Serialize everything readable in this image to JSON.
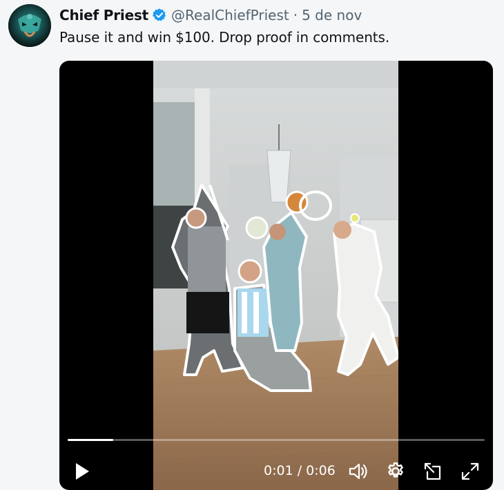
{
  "tweet": {
    "author_name": "Chief Priest",
    "handle": "@RealChiefPriest",
    "separator": "·",
    "date": "5 de nov",
    "text": "Pause it and win $100. Drop proof in comments."
  },
  "video": {
    "time_current": "0:01",
    "time_separator": "/",
    "time_total": "0:06",
    "progress_fraction": 0.11
  },
  "icons": {
    "verified": "verified-badge-icon",
    "play": "play-icon",
    "volume": "volume-icon",
    "settings": "gear-icon",
    "popout": "picture-in-picture-icon",
    "fullscreen": "fullscreen-icon"
  },
  "colors": {
    "verified_blue": "#1d9bf0",
    "text_primary": "#0f1419",
    "text_secondary": "#536471"
  }
}
